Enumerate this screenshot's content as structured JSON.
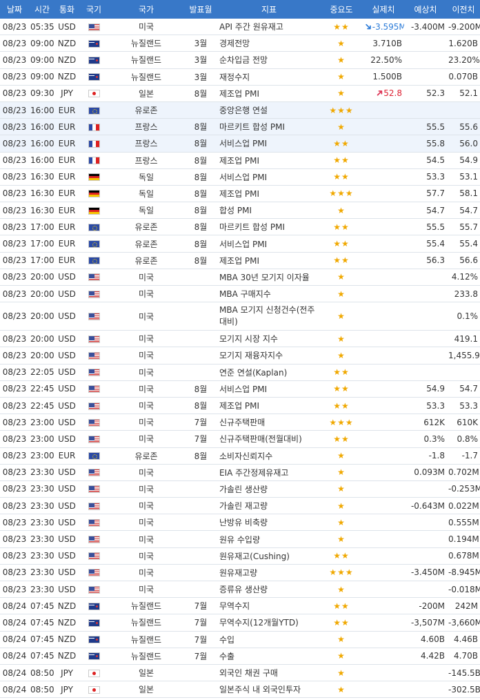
{
  "headers": [
    "날짜",
    "시간",
    "통화",
    "국기",
    "국가",
    "발표월",
    "지표",
    "중요도",
    "실제치",
    "예상치",
    "이전치"
  ],
  "rows": [
    {
      "date": "08/23",
      "time": "05:35",
      "cur": "USD",
      "flag": "us",
      "country": "미국",
      "month": "",
      "indicator": "API 주간 원유재고",
      "stars": 2,
      "actual": "-3.595M",
      "trend": "down",
      "forecast": "-3.400M",
      "previous": "-9.200M"
    },
    {
      "date": "08/23",
      "time": "09:00",
      "cur": "NZD",
      "flag": "nz",
      "country": "뉴질랜드",
      "month": "3월",
      "indicator": "경제전망",
      "stars": 1,
      "actual": "3.710B",
      "trend": "",
      "forecast": "",
      "previous": "1.620B"
    },
    {
      "date": "08/23",
      "time": "09:00",
      "cur": "NZD",
      "flag": "nz",
      "country": "뉴질랜드",
      "month": "3월",
      "indicator": "순차입금 전망",
      "stars": 1,
      "actual": "22.50%",
      "trend": "",
      "forecast": "",
      "previous": "23.20%"
    },
    {
      "date": "08/23",
      "time": "09:00",
      "cur": "NZD",
      "flag": "nz",
      "country": "뉴질랜드",
      "month": "3월",
      "indicator": "재정수지",
      "stars": 1,
      "actual": "1.500B",
      "trend": "",
      "forecast": "",
      "previous": "0.070B"
    },
    {
      "date": "08/23",
      "time": "09:30",
      "cur": "JPY",
      "flag": "jp",
      "country": "일본",
      "month": "8월",
      "indicator": "제조업 PMI",
      "stars": 1,
      "actual": "52.8",
      "trend": "up",
      "forecast": "52.3",
      "previous": "52.1"
    },
    {
      "date": "08/23",
      "time": "16:00",
      "cur": "EUR",
      "flag": "eu",
      "country": "유로존",
      "month": "",
      "indicator": "중앙은행 연설",
      "stars": 3,
      "actual": "",
      "trend": "",
      "forecast": "",
      "previous": "",
      "alt": true
    },
    {
      "date": "08/23",
      "time": "16:00",
      "cur": "EUR",
      "flag": "fr",
      "country": "프랑스",
      "month": "8월",
      "indicator": "마르키트 합성 PMI",
      "stars": 1,
      "actual": "",
      "trend": "",
      "forecast": "55.5",
      "previous": "55.6",
      "alt": true
    },
    {
      "date": "08/23",
      "time": "16:00",
      "cur": "EUR",
      "flag": "fr",
      "country": "프랑스",
      "month": "8월",
      "indicator": "서비스업 PMI",
      "stars": 2,
      "actual": "",
      "trend": "",
      "forecast": "55.8",
      "previous": "56.0",
      "alt": true
    },
    {
      "date": "08/23",
      "time": "16:00",
      "cur": "EUR",
      "flag": "fr",
      "country": "프랑스",
      "month": "8월",
      "indicator": "제조업 PMI",
      "stars": 2,
      "actual": "",
      "trend": "",
      "forecast": "54.5",
      "previous": "54.9"
    },
    {
      "date": "08/23",
      "time": "16:30",
      "cur": "EUR",
      "flag": "de",
      "country": "독일",
      "month": "8월",
      "indicator": "서비스업 PMI",
      "stars": 2,
      "actual": "",
      "trend": "",
      "forecast": "53.3",
      "previous": "53.1"
    },
    {
      "date": "08/23",
      "time": "16:30",
      "cur": "EUR",
      "flag": "de",
      "country": "독일",
      "month": "8월",
      "indicator": "제조업 PMI",
      "stars": 3,
      "actual": "",
      "trend": "",
      "forecast": "57.7",
      "previous": "58.1"
    },
    {
      "date": "08/23",
      "time": "16:30",
      "cur": "EUR",
      "flag": "de",
      "country": "독일",
      "month": "8월",
      "indicator": "합성 PMI",
      "stars": 1,
      "actual": "",
      "trend": "",
      "forecast": "54.7",
      "previous": "54.7"
    },
    {
      "date": "08/23",
      "time": "17:00",
      "cur": "EUR",
      "flag": "eu",
      "country": "유로존",
      "month": "8월",
      "indicator": "마르키트 합성 PMI",
      "stars": 2,
      "actual": "",
      "trend": "",
      "forecast": "55.5",
      "previous": "55.7"
    },
    {
      "date": "08/23",
      "time": "17:00",
      "cur": "EUR",
      "flag": "eu",
      "country": "유로존",
      "month": "8월",
      "indicator": "서비스업 PMI",
      "stars": 2,
      "actual": "",
      "trend": "",
      "forecast": "55.4",
      "previous": "55.4"
    },
    {
      "date": "08/23",
      "time": "17:00",
      "cur": "EUR",
      "flag": "eu",
      "country": "유로존",
      "month": "8월",
      "indicator": "제조업 PMI",
      "stars": 2,
      "actual": "",
      "trend": "",
      "forecast": "56.3",
      "previous": "56.6"
    },
    {
      "date": "08/23",
      "time": "20:00",
      "cur": "USD",
      "flag": "us",
      "country": "미국",
      "month": "",
      "indicator": "MBA 30년 모기지 이자율",
      "stars": 1,
      "actual": "",
      "trend": "",
      "forecast": "",
      "previous": "4.12%"
    },
    {
      "date": "08/23",
      "time": "20:00",
      "cur": "USD",
      "flag": "us",
      "country": "미국",
      "month": "",
      "indicator": "MBA 구매지수",
      "stars": 1,
      "actual": "",
      "trend": "",
      "forecast": "",
      "previous": "233.8"
    },
    {
      "date": "08/23",
      "time": "20:00",
      "cur": "USD",
      "flag": "us",
      "country": "미국",
      "month": "",
      "indicator": "MBA 모기지 신청건수(전주대비)",
      "stars": 1,
      "actual": "",
      "trend": "",
      "forecast": "",
      "previous": "0.1%",
      "tall": true
    },
    {
      "date": "08/23",
      "time": "20:00",
      "cur": "USD",
      "flag": "us",
      "country": "미국",
      "month": "",
      "indicator": "모기지 시장 지수",
      "stars": 1,
      "actual": "",
      "trend": "",
      "forecast": "",
      "previous": "419.1"
    },
    {
      "date": "08/23",
      "time": "20:00",
      "cur": "USD",
      "flag": "us",
      "country": "미국",
      "month": "",
      "indicator": "모기지 재융자지수",
      "stars": 1,
      "actual": "",
      "trend": "",
      "forecast": "",
      "previous": "1,455.9"
    },
    {
      "date": "08/23",
      "time": "22:05",
      "cur": "USD",
      "flag": "us",
      "country": "미국",
      "month": "",
      "indicator": "연준 연설(Kaplan)",
      "stars": 2,
      "actual": "",
      "trend": "",
      "forecast": "",
      "previous": ""
    },
    {
      "date": "08/23",
      "time": "22:45",
      "cur": "USD",
      "flag": "us",
      "country": "미국",
      "month": "8월",
      "indicator": "서비스업 PMI",
      "stars": 2,
      "actual": "",
      "trend": "",
      "forecast": "54.9",
      "previous": "54.7"
    },
    {
      "date": "08/23",
      "time": "22:45",
      "cur": "USD",
      "flag": "us",
      "country": "미국",
      "month": "8월",
      "indicator": "제조업 PMI",
      "stars": 2,
      "actual": "",
      "trend": "",
      "forecast": "53.3",
      "previous": "53.3"
    },
    {
      "date": "08/23",
      "time": "23:00",
      "cur": "USD",
      "flag": "us",
      "country": "미국",
      "month": "7월",
      "indicator": "신규주택판매",
      "stars": 3,
      "actual": "",
      "trend": "",
      "forecast": "612K",
      "previous": "610K"
    },
    {
      "date": "08/23",
      "time": "23:00",
      "cur": "USD",
      "flag": "us",
      "country": "미국",
      "month": "7월",
      "indicator": "신규주택판매(전월대비)",
      "stars": 2,
      "actual": "",
      "trend": "",
      "forecast": "0.3%",
      "previous": "0.8%"
    },
    {
      "date": "08/23",
      "time": "23:00",
      "cur": "EUR",
      "flag": "eu",
      "country": "유로존",
      "month": "8월",
      "indicator": "소비자신뢰지수",
      "stars": 1,
      "actual": "",
      "trend": "",
      "forecast": "-1.8",
      "previous": "-1.7"
    },
    {
      "date": "08/23",
      "time": "23:30",
      "cur": "USD",
      "flag": "us",
      "country": "미국",
      "month": "",
      "indicator": "EIA 주간정제유재고",
      "stars": 1,
      "actual": "",
      "trend": "",
      "forecast": "0.093M",
      "previous": "0.702M"
    },
    {
      "date": "08/23",
      "time": "23:30",
      "cur": "USD",
      "flag": "us",
      "country": "미국",
      "month": "",
      "indicator": "가솔린 생산량",
      "stars": 1,
      "actual": "",
      "trend": "",
      "forecast": "",
      "previous": "-0.253M"
    },
    {
      "date": "08/23",
      "time": "23:30",
      "cur": "USD",
      "flag": "us",
      "country": "미국",
      "month": "",
      "indicator": "가솔린 재고량",
      "stars": 1,
      "actual": "",
      "trend": "",
      "forecast": "-0.643M",
      "previous": "0.022M"
    },
    {
      "date": "08/23",
      "time": "23:30",
      "cur": "USD",
      "flag": "us",
      "country": "미국",
      "month": "",
      "indicator": "난방유 비축량",
      "stars": 1,
      "actual": "",
      "trend": "",
      "forecast": "",
      "previous": "0.555M"
    },
    {
      "date": "08/23",
      "time": "23:30",
      "cur": "USD",
      "flag": "us",
      "country": "미국",
      "month": "",
      "indicator": "원유 수입량",
      "stars": 1,
      "actual": "",
      "trend": "",
      "forecast": "",
      "previous": "0.194M"
    },
    {
      "date": "08/23",
      "time": "23:30",
      "cur": "USD",
      "flag": "us",
      "country": "미국",
      "month": "",
      "indicator": "원유재고(Cushing)",
      "stars": 2,
      "actual": "",
      "trend": "",
      "forecast": "",
      "previous": "0.678M"
    },
    {
      "date": "08/23",
      "time": "23:30",
      "cur": "USD",
      "flag": "us",
      "country": "미국",
      "month": "",
      "indicator": "원유재고량",
      "stars": 3,
      "actual": "",
      "trend": "",
      "forecast": "-3.450M",
      "previous": "-8.945M"
    },
    {
      "date": "08/23",
      "time": "23:30",
      "cur": "USD",
      "flag": "us",
      "country": "미국",
      "month": "",
      "indicator": "증류유 생산량",
      "stars": 1,
      "actual": "",
      "trend": "",
      "forecast": "",
      "previous": "-0.018M"
    },
    {
      "date": "08/24",
      "time": "07:45",
      "cur": "NZD",
      "flag": "nz",
      "country": "뉴질랜드",
      "month": "7월",
      "indicator": "무역수지",
      "stars": 2,
      "actual": "",
      "trend": "",
      "forecast": "-200M",
      "previous": "242M"
    },
    {
      "date": "08/24",
      "time": "07:45",
      "cur": "NZD",
      "flag": "nz",
      "country": "뉴질랜드",
      "month": "7월",
      "indicator": "무역수지(12개월YTD)",
      "stars": 2,
      "actual": "",
      "trend": "",
      "forecast": "-3,507M",
      "previous": "-3,660M"
    },
    {
      "date": "08/24",
      "time": "07:45",
      "cur": "NZD",
      "flag": "nz",
      "country": "뉴질랜드",
      "month": "7월",
      "indicator": "수입",
      "stars": 1,
      "actual": "",
      "trend": "",
      "forecast": "4.60B",
      "previous": "4.46B"
    },
    {
      "date": "08/24",
      "time": "07:45",
      "cur": "NZD",
      "flag": "nz",
      "country": "뉴질랜드",
      "month": "7월",
      "indicator": "수출",
      "stars": 1,
      "actual": "",
      "trend": "",
      "forecast": "4.42B",
      "previous": "4.70B"
    },
    {
      "date": "08/24",
      "time": "08:50",
      "cur": "JPY",
      "flag": "jp",
      "country": "일본",
      "month": "",
      "indicator": "외국인 채권 구매",
      "stars": 1,
      "actual": "",
      "trend": "",
      "forecast": "",
      "previous": "-145.5B"
    },
    {
      "date": "08/24",
      "time": "08:50",
      "cur": "JPY",
      "flag": "jp",
      "country": "일본",
      "month": "",
      "indicator": "일본주식 내 외국인투자",
      "stars": 1,
      "actual": "",
      "trend": "",
      "forecast": "",
      "previous": "-302.5B"
    }
  ]
}
